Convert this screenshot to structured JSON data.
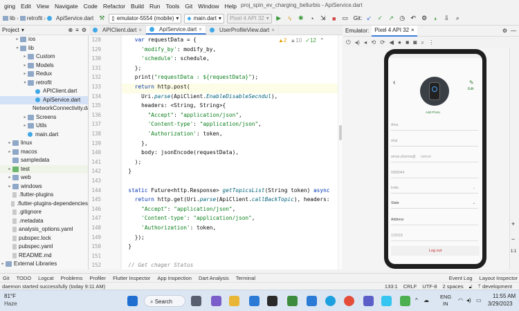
{
  "window": {
    "title": "proj_spin_ev_charging_bellurbis - ApiService.dart",
    "menu": [
      "ging",
      "Edit",
      "View",
      "Navigate",
      "Code",
      "Refactor",
      "Build",
      "Run",
      "Tools",
      "Git",
      "Window",
      "Help"
    ]
  },
  "toolbar": {
    "breadcrumbs": [
      "lib",
      "retrofit",
      "ApiService.dart"
    ],
    "device": "emulator-5554 (mobile)",
    "run_config": "main.dart",
    "avd": "Pixel 4 API 32",
    "git_label": "Git:"
  },
  "project": {
    "header": "Project",
    "tree": [
      {
        "label": "ios",
        "depth": 1,
        "icon": "folder",
        "arrow": "▸"
      },
      {
        "label": "lib",
        "depth": 1,
        "icon": "folder",
        "arrow": "▾"
      },
      {
        "label": "Custom",
        "depth": 2,
        "icon": "folder",
        "arrow": "▸"
      },
      {
        "label": "Models",
        "depth": 2,
        "icon": "folder",
        "arrow": "▸"
      },
      {
        "label": "Redux",
        "depth": 2,
        "icon": "folder",
        "arrow": "▸"
      },
      {
        "label": "retrofit",
        "depth": 2,
        "icon": "folder",
        "arrow": "▾"
      },
      {
        "label": "APIClient.dart",
        "depth": 3,
        "icon": "dart",
        "arrow": ""
      },
      {
        "label": "ApiService.dart",
        "depth": 3,
        "icon": "dart",
        "arrow": "",
        "selected": true
      },
      {
        "label": "NetworkConnectivity.da",
        "depth": 3,
        "icon": "dart",
        "arrow": ""
      },
      {
        "label": "Screens",
        "depth": 2,
        "icon": "folder",
        "arrow": "▸"
      },
      {
        "label": "Utils",
        "depth": 2,
        "icon": "folder",
        "arrow": "▸"
      },
      {
        "label": "main.dart",
        "depth": 2,
        "icon": "dart",
        "arrow": ""
      },
      {
        "label": "linux",
        "depth": 0,
        "icon": "folder",
        "arrow": "▸"
      },
      {
        "label": "macos",
        "depth": 0,
        "icon": "folder",
        "arrow": "▸"
      },
      {
        "label": "sampledata",
        "depth": 0,
        "icon": "folder",
        "arrow": ""
      },
      {
        "label": "test",
        "depth": 0,
        "icon": "test",
        "arrow": "▸",
        "highlight": true
      },
      {
        "label": "web",
        "depth": 0,
        "icon": "folder",
        "arrow": "▸"
      },
      {
        "label": "windows",
        "depth": 0,
        "icon": "folder",
        "arrow": "▸"
      },
      {
        "label": ".flutter-plugins",
        "depth": 0,
        "icon": "file",
        "arrow": ""
      },
      {
        "label": ".flutter-plugins-dependencies",
        "depth": 0,
        "icon": "file",
        "arrow": ""
      },
      {
        "label": ".gitignore",
        "depth": 0,
        "icon": "file",
        "arrow": ""
      },
      {
        "label": ".metadata",
        "depth": 0,
        "icon": "file",
        "arrow": ""
      },
      {
        "label": "analysis_options.yaml",
        "depth": 0,
        "icon": "file",
        "arrow": ""
      },
      {
        "label": "pubspec.lock",
        "depth": 0,
        "icon": "file",
        "arrow": ""
      },
      {
        "label": "pubspec.yaml",
        "depth": 0,
        "icon": "file",
        "arrow": ""
      },
      {
        "label": "README.md",
        "depth": 0,
        "icon": "file",
        "arrow": ""
      },
      {
        "label": "External Libraries",
        "depth": -1,
        "icon": "folder",
        "arrow": "▸"
      }
    ]
  },
  "editor": {
    "tabs": [
      {
        "label": "APIClient.dart",
        "active": false
      },
      {
        "label": "ApiService.dart",
        "active": true
      },
      {
        "label": "UserProfileView.dart",
        "active": false
      }
    ],
    "inspections": {
      "warnings": "▲2",
      "weak": "▲10",
      "typos": "✓12"
    },
    "lines": [
      {
        "n": "128",
        "html": "    <span class=\"kw\">var</span> requestData = {"
      },
      {
        "n": "129",
        "html": "      <span class=\"str\">'modify_by'</span>: modify_by,"
      },
      {
        "n": "130",
        "html": "      <span class=\"str\">'schedule'</span>: schedule,"
      },
      {
        "n": "131",
        "html": "    };"
      },
      {
        "n": "132",
        "html": "    print(<span class=\"str\">\"requestData : ${requestData}\"</span>);"
      },
      {
        "n": "133",
        "html": "    <span class=\"kw\">return</span> http.post(",
        "hl": true
      },
      {
        "n": "134",
        "html": "      Uri.<span class=\"fn\">parse</span>(ApiClient.<span class=\"fn\">EnableDisableSecndul</span>),"
      },
      {
        "n": "135",
        "html": "      headers: &lt;String, String&gt;{"
      },
      {
        "n": "136",
        "html": "        <span class=\"str\">\"Accept\"</span>: <span class=\"str\">\"application/json\"</span>,"
      },
      {
        "n": "137",
        "html": "        <span class=\"str\">'Content-type'</span>: <span class=\"str\">\"application/json\"</span>,"
      },
      {
        "n": "138",
        "html": "        <span class=\"str\">'Authorization'</span>: token,"
      },
      {
        "n": "139",
        "html": "      },"
      },
      {
        "n": "140",
        "html": "      body: jsonEncode(requestData),"
      },
      {
        "n": "141",
        "html": "    );"
      },
      {
        "n": "142",
        "html": "  }"
      },
      {
        "n": "143",
        "html": ""
      },
      {
        "n": "144",
        "html": "  <span class=\"kw\">static</span> Future&lt;http.Response&gt; <span class=\"fn\">getTopicsList</span>(String token) <span class=\"kw\">async</span>"
      },
      {
        "n": "145",
        "html": "    <span class=\"kw\">return</span> http.get(Uri.<span class=\"fn\">parse</span>(ApiClient.<span class=\"fn\">callBackTopic</span>), headers:"
      },
      {
        "n": "146",
        "html": "      <span class=\"str\">\"Accept\"</span>: <span class=\"str\">\"application/json\"</span>,"
      },
      {
        "n": "147",
        "html": "      <span class=\"str\">'Content-type'</span>: <span class=\"str\">\"application/json\"</span>,"
      },
      {
        "n": "148",
        "html": "      <span class=\"str\">'Authorization'</span>: token,"
      },
      {
        "n": "149",
        "html": "    });"
      },
      {
        "n": "150",
        "html": "  }"
      },
      {
        "n": "151",
        "html": ""
      },
      {
        "n": "152",
        "html": "  <span class=\"cm\">// Get chager Status</span>"
      }
    ]
  },
  "emulator": {
    "label": "Emulator:",
    "tab": "Pixel 4 API 32",
    "app": {
      "edit_label": "Edit",
      "add_photo": "Add Photo",
      "fields": [
        "Ama",
        "shal",
        "aman.sharma@",
        "com.in",
        "0998344",
        "India",
        "State",
        "Address",
        "122018"
      ],
      "logout": "Log out"
    }
  },
  "bottom_tabs": [
    "Git",
    "TODO",
    "Logcat",
    "Problems",
    "Profiler",
    "Flutter Inspector",
    "App Inspection",
    "Dart Analysis",
    "Terminal",
    "Event Log",
    "Layout Inspector"
  ],
  "status": {
    "message": "daemon started successfully (today 9:11 AM)",
    "position": "133:1",
    "line_sep": "CRLF",
    "encoding": "UTF-8",
    "indent": "2 spaces",
    "branch": "development"
  },
  "taskbar": {
    "weather_temp": "81°F",
    "weather_desc": "Haze",
    "search": "Search",
    "lang": "ENG",
    "region": "IN",
    "time": "11:55 AM",
    "date": "3/29/2023"
  }
}
